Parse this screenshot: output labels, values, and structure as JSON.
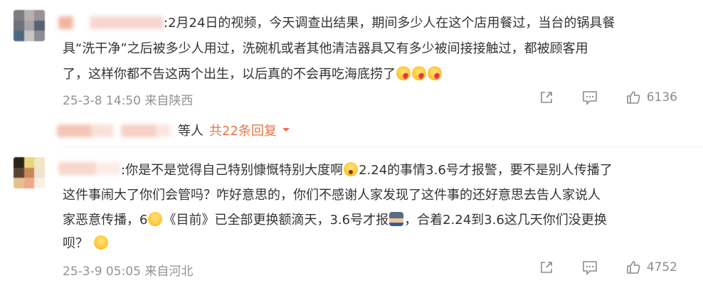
{
  "colors": {
    "link_orange": "#eb7340",
    "meta_gray": "#939393",
    "text": "#333333"
  },
  "comments": [
    {
      "text_lines": [
        ":2月24日的视频，今天调查出结果，期间多少人在这个店用餐过，当台的锅具餐",
        "具“洗干净”之后被多少人用过，洗碗机或者其他清洁器具又有多少被间接接触过，都被顾客用",
        "了，这样你都不告这两个出生，以后真的不会再吃海底捞了"
      ],
      "time": "25-3-8 14:50",
      "location": "来自陕西",
      "likes": "6136",
      "icons": {
        "share": "share-icon",
        "comment": "comment-icon",
        "like": "thumbs-up-icon"
      }
    },
    {
      "text_lines": [
        ":你是不是觉得自己特别慷慨特别大度啊",
        "2.24的事情3.6号才报警，要不是别人传播了",
        "这件事闹大了你们会管吗？咋好意思的，你们不感谢人家发现了这件事的还好意思去告人家说人",
        "家恶意传播，6",
        "《目前》已全部更换额滴天，3.6号才报",
        "，合着2.24到3.6这几天你们没更换",
        "呗？"
      ],
      "time": "25-3-9 05:05",
      "location": "来自河北",
      "likes": "4752"
    }
  ],
  "replies": {
    "by_label": "等人",
    "count_label": "共22条回复",
    "chevron": "chevron-down-icon"
  }
}
